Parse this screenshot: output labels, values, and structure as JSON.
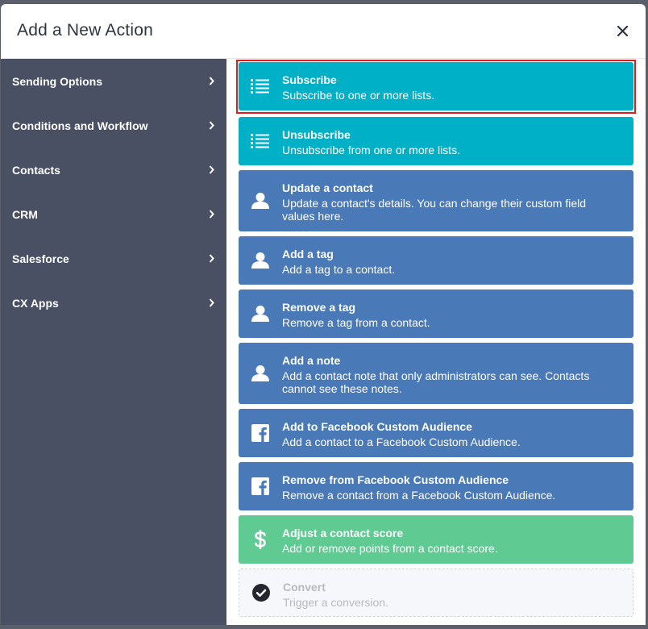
{
  "modal": {
    "title": "Add a New Action"
  },
  "sidebar": {
    "items": [
      {
        "label": "Sending Options"
      },
      {
        "label": "Conditions and Workflow"
      },
      {
        "label": "Contacts"
      },
      {
        "label": "CRM"
      },
      {
        "label": "Salesforce"
      },
      {
        "label": "CX Apps"
      }
    ]
  },
  "actions": [
    {
      "title": "Subscribe",
      "description": "Subscribe to one or more lists.",
      "icon": "list-icon",
      "color": "#00b0c7",
      "selected": true
    },
    {
      "title": "Unsubscribe",
      "description": "Unsubscribe from one or more lists.",
      "icon": "list-icon",
      "color": "#00b0c7"
    },
    {
      "title": "Update a contact",
      "description": "Update a contact's details. You can change their custom field values here.",
      "icon": "user-icon",
      "color": "#4a79b7"
    },
    {
      "title": "Add a tag",
      "description": "Add a tag to a contact.",
      "icon": "user-icon",
      "color": "#4a79b7"
    },
    {
      "title": "Remove a tag",
      "description": "Remove a tag from a contact.",
      "icon": "user-icon",
      "color": "#4a79b7"
    },
    {
      "title": "Add a note",
      "description": "Add a contact note that only administrators can see. Contacts cannot see these notes.",
      "icon": "user-icon",
      "color": "#4a79b7"
    },
    {
      "title": "Add to Facebook Custom Audience",
      "description": "Add a contact to a Facebook Custom Audience.",
      "icon": "facebook-icon",
      "color": "#4a79b7"
    },
    {
      "title": "Remove from Facebook Custom Audience",
      "description": "Remove a contact from a Facebook Custom Audience.",
      "icon": "facebook-icon",
      "color": "#4a79b7"
    },
    {
      "title": "Adjust a contact score",
      "description": "Add or remove points from a contact score.",
      "icon": "dollar-icon",
      "color": "#5fca92"
    },
    {
      "title": "Convert",
      "description": "Trigger a conversion.",
      "icon": "check-circle-icon",
      "disabled": true
    }
  ]
}
